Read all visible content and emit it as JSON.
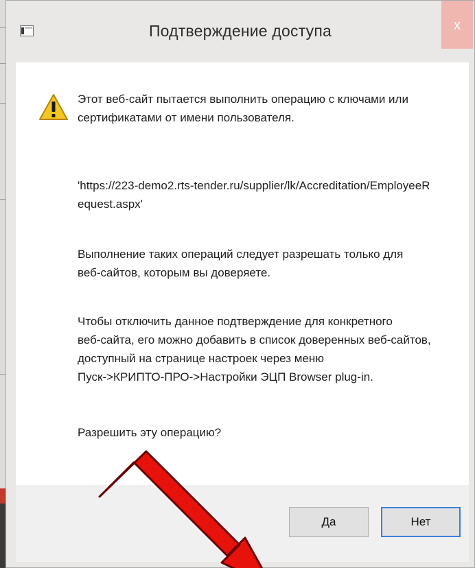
{
  "dialog": {
    "title": "Подтверждение доступа",
    "close_label": "x",
    "messages": [
      "Этот веб-сайт пытается выполнить операцию с ключами или\nсертификатами от имени пользователя.",
      "'https://223-demo2.rts-tender.ru/supplier/lk/Accreditation/EmployeeR\nequest.aspx'",
      "Выполнение таких операций следует разрешать только для\nвеб-сайтов, которым вы доверяете.",
      "Чтобы отключить данное подтверждение для конкретного\nвеб-сайта, его можно добавить в список доверенных веб-сайтов,\nдоступный на странице настроек через меню\nПуск->КРИПТО-ПРО->Настройки ЭЦП Browser plug-in.",
      "Разрешить эту операцию?"
    ],
    "buttons": {
      "yes_label": "Да",
      "no_label": "Нет"
    }
  },
  "icons": {
    "app": "window-icon",
    "warning": "warning-icon",
    "annotation": "red-arrow-icon"
  },
  "colors": {
    "close_button": "#f0b6b0",
    "warning_yellow": "#f3c623",
    "arrow_red": "#e8120c",
    "focus_border": "#3c7fd6"
  }
}
